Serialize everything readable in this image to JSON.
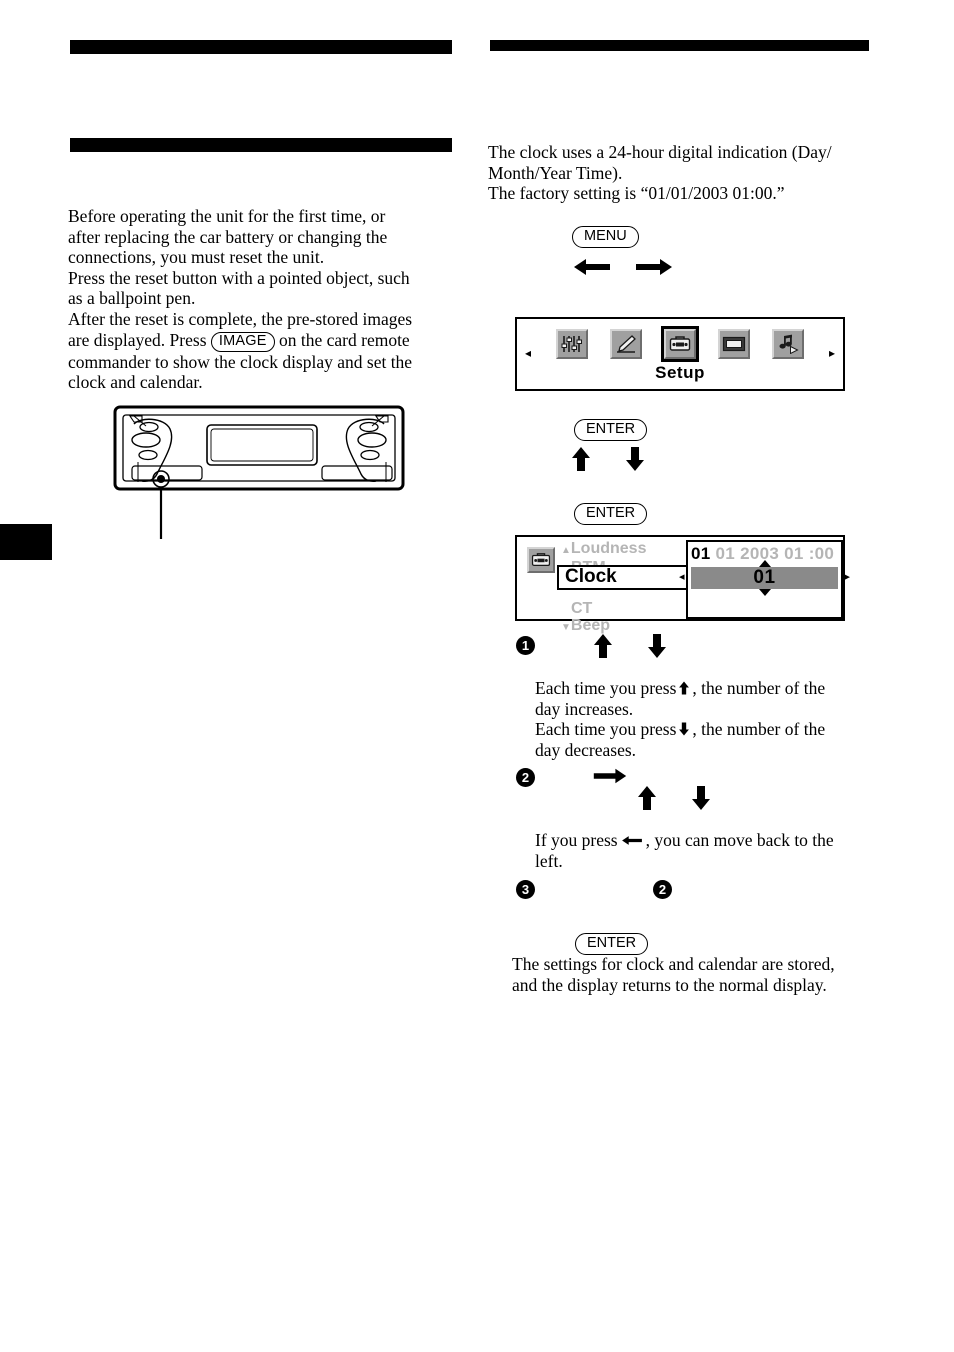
{
  "page": {
    "index_tab": "",
    "left_column": {
      "heading_redacted": "",
      "subheading_redacted": "",
      "paragraph_lines": [
        "Before operating the unit for the first time, or",
        "after replacing the car battery or changing the",
        "connections, you must reset the unit.",
        "Press the reset button with a pointed object, such",
        "as a ballpoint pen.",
        "After the reset is complete, the pre-stored images"
      ],
      "paragraph_tail_before_key": "are displayed. Press",
      "image_key_label": "IMAGE",
      "paragraph_tail_after_key": "on the card remote",
      "paragraph_final_lines": [
        "commander to show the clock display and set the",
        "clock and calendar."
      ],
      "illustration_name": "car-stereo-front-panel",
      "callout_target": "reset-button"
    },
    "right_column": {
      "heading_redacted": "",
      "intro_lines": [
        "The clock uses a 24-hour digital indication (Day/",
        "Month/Year Time).",
        "The factory setting is “01/01/2003 01:00.”"
      ],
      "menu_key_label": "MENU",
      "menu_arrows": [
        "left-arrow",
        "right-arrow"
      ],
      "setup_panel": {
        "caret_left": "◂",
        "caret_right": "▸",
        "label": "Setup",
        "icons": [
          {
            "name": "equalizer-icon",
            "selected": false
          },
          {
            "name": "edit-pen-icon",
            "selected": false
          },
          {
            "name": "toolbox-setup-icon",
            "selected": true
          },
          {
            "name": "display-screen-icon",
            "selected": false
          },
          {
            "name": "music-note-play-icon",
            "selected": false
          }
        ]
      },
      "enter_key_label_1": "ENTER",
      "updown_arrows": [
        "up-arrow",
        "down-arrow"
      ],
      "enter_key_label_2": "ENTER",
      "clock_panel": {
        "toolbox_icon": "toolbox-setup-icon",
        "scroll_up_caret": "▲",
        "scroll_down_caret": "▼",
        "menu_items": [
          {
            "label": "Loudness",
            "selected": false
          },
          {
            "label": "BTM",
            "selected": false
          },
          {
            "label": "Clock",
            "selected": true
          },
          {
            "label": "CT",
            "selected": false
          },
          {
            "label": "Beep",
            "selected": false
          }
        ],
        "date_line": [
          {
            "text": "01",
            "active": true
          },
          {
            "text": "01",
            "active": false
          },
          {
            "text": "2003",
            "active": false
          },
          {
            "text": "01",
            "active": false
          },
          {
            "text": ":00",
            "active": false
          }
        ],
        "highlight_value": "01",
        "caret_left": "◂",
        "caret_right": "▸",
        "caret_up": "▲",
        "caret_down": "▼"
      },
      "step1": {
        "bullet": "1",
        "arrows": [
          "up-arrow",
          "down-arrow"
        ],
        "lines": [
          "Each time you press ↑, the number of the",
          "day increases.",
          "Each time you press ↓, the number of the",
          "day decreases."
        ],
        "text_a_before": "Each time you press",
        "text_a_after": ", the number of the",
        "text_a_line2": "day increases.",
        "text_b_before": "Each time you press",
        "text_b_after": ", the number of the",
        "text_b_line2": "day decreases."
      },
      "step2": {
        "bullet": "2",
        "arrows": [
          "right-arrow",
          "up-arrow",
          "down-arrow"
        ],
        "text_before": "If you press",
        "text_after": ", you can move back to the",
        "text_line2": "left."
      },
      "step3": {
        "bullet": "3",
        "reference_bullet": "2"
      },
      "final_enter_label": "ENTER",
      "final_lines": [
        "The settings for clock and calendar are stored,",
        "and the display returns to the normal display."
      ]
    }
  },
  "colors": {
    "ink": "#000000",
    "lcd_gray_dim": "#b5b5b5",
    "lcd_gray_highlight": "#8a8a8a",
    "icon_face": "#a0a0a0",
    "icon_light": "#d4d4d4",
    "icon_shadow": "#6e6e6e"
  }
}
